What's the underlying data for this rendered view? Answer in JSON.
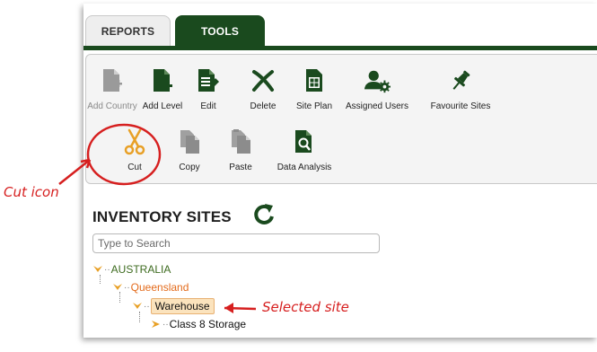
{
  "tabs": {
    "reports": "REPORTS",
    "tools": "TOOLS"
  },
  "toolbar": {
    "row1": [
      {
        "label": "Add Country",
        "icon": "add-document-icon",
        "enabled": false
      },
      {
        "label": "Add Level",
        "icon": "add-document-icon",
        "enabled": true
      },
      {
        "label": "Edit",
        "icon": "edit-document-icon",
        "enabled": true
      },
      {
        "label": "Delete",
        "icon": "delete-x-icon",
        "enabled": true
      },
      {
        "label": "Site Plan",
        "icon": "site-plan-icon",
        "enabled": true
      },
      {
        "label": "Assigned Users",
        "icon": "user-gear-icon",
        "enabled": true
      },
      {
        "label": "Favourite Sites",
        "icon": "pin-icon",
        "enabled": true
      }
    ],
    "row2": [
      {
        "label": "Cut",
        "icon": "scissors-icon",
        "enabled": true
      },
      {
        "label": "Copy",
        "icon": "copy-icon",
        "enabled": false
      },
      {
        "label": "Paste",
        "icon": "paste-icon",
        "enabled": false
      },
      {
        "label": "Data Analysis",
        "icon": "search-document-icon",
        "enabled": true
      }
    ]
  },
  "inventory": {
    "title": "INVENTORY SITES",
    "search_placeholder": "Type to Search"
  },
  "tree": {
    "country": "AUSTRALIA",
    "state": "Queensland",
    "site": "Warehouse",
    "child": "Class 8 Storage"
  },
  "annotations": {
    "cut_icon": "Cut icon",
    "selected_site": "Selected site"
  },
  "colors": {
    "tools_tab": "#1a4a1e",
    "annotation_red": "#d61f1f",
    "tree_green": "#3d6b1f",
    "tree_orange": "#e36a1a",
    "cut_scissors": "#e8a026"
  }
}
